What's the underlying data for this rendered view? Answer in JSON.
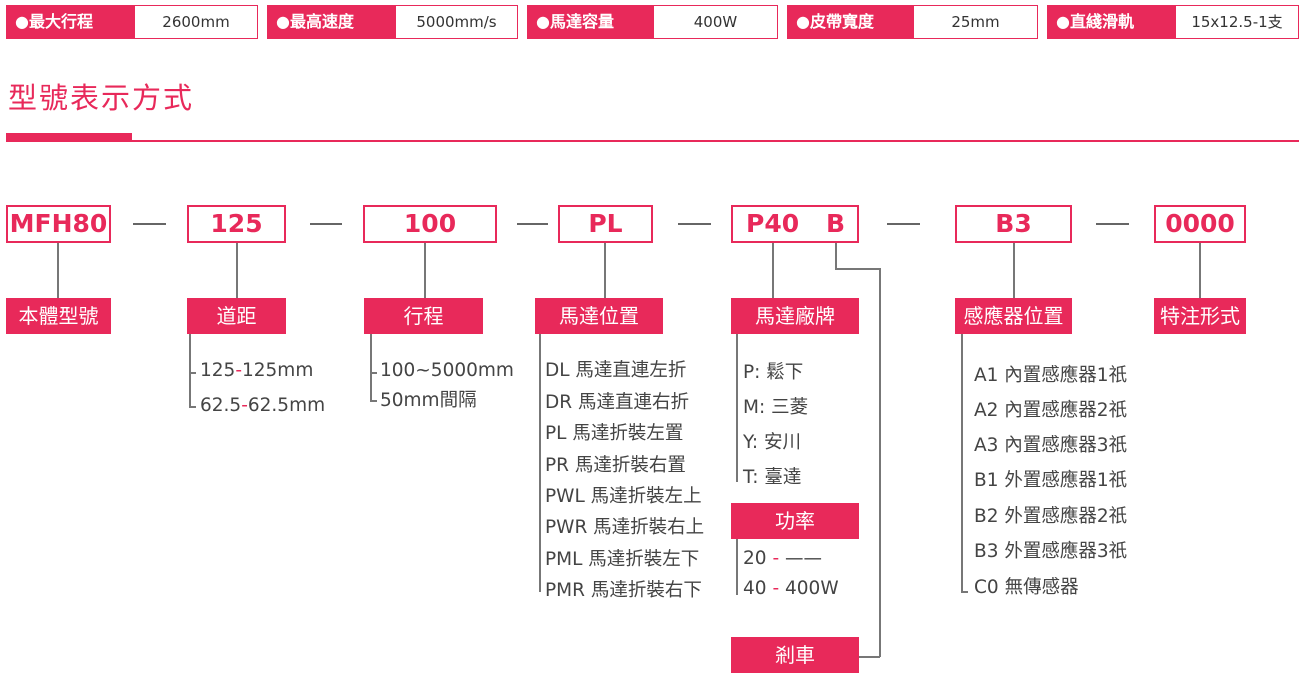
{
  "specs": [
    {
      "label": "●最大行程",
      "value": "2600mm"
    },
    {
      "label": "●最高速度",
      "value": "5000mm/s"
    },
    {
      "label": "●馬達容量",
      "value": "400W"
    },
    {
      "label": "●皮帶寬度",
      "value": "25mm"
    },
    {
      "label": "●直綫滑軌",
      "value": "15x12.5-1支"
    }
  ],
  "section_title": "型號表示方式",
  "codes": {
    "model": "MFH80",
    "pitch": "125",
    "stroke": "100",
    "motor_position": "PL",
    "motor_brand": "P40",
    "brake": "B",
    "sensor": "B3",
    "special": "0000"
  },
  "separator": "—",
  "labels": {
    "model": "本體型號",
    "pitch": "道距",
    "stroke": "行程",
    "motor_position": "馬達位置",
    "motor_brand": "馬達廠牌",
    "power": "功率",
    "brake": "剎車",
    "sensor": "感應器位置",
    "special": "特注形式"
  },
  "pitch_options": [
    {
      "code": "125",
      "sep": "-",
      "value": "125mm"
    },
    {
      "code": "62.5",
      "sep": "-",
      "value": "62.5mm"
    }
  ],
  "stroke_options": [
    "100~5000mm",
    "50mm間隔"
  ],
  "motor_position_options": [
    "DL 馬達直連左折",
    "DR 馬達直連右折",
    "PL 馬達折裝左置",
    "PR 馬達折裝右置",
    "PWL 馬達折裝左上",
    "PWR 馬達折裝右上",
    "PML 馬達折裝左下",
    "PMR 馬達折裝右下"
  ],
  "motor_brand_options": [
    "P: 鬆下",
    "M: 三菱",
    "Y: 安川",
    "T: 臺達"
  ],
  "power_options": [
    {
      "code": "20",
      "sep": "-",
      "value": "——"
    },
    {
      "code": "40",
      "sep": "-",
      "value": "400W"
    }
  ],
  "sensor_options": [
    "A1  內置感應器1祇",
    "A2  內置感應器2祇",
    "A3  內置感應器3祇",
    "B1  外置感應器1祇",
    "B2  外置感應器2祇",
    "B3  外置感應器3祇",
    "C0  無傳感器"
  ],
  "colors": {
    "accent": "#e8295a",
    "text": "#333333",
    "line": "#777777"
  }
}
